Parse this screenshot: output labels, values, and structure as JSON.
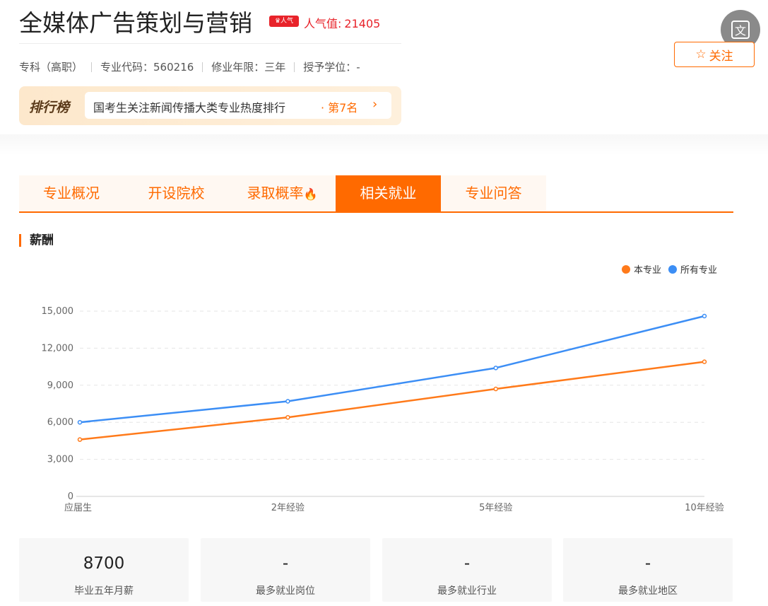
{
  "header": {
    "title": "全媒体广告策划与营销",
    "hot_badge": "人气",
    "popularity_label": "人气值:",
    "popularity_value": "21405",
    "meta": [
      "专科（高职）",
      "专业代码：560216",
      "修业年限：三年",
      "授予学位：-"
    ]
  },
  "ranking": {
    "title": "排行榜",
    "text": "国考生关注新闻传播大类专业热度排行",
    "position": "· 第7名",
    "arrow": "›"
  },
  "translate_button": {
    "label": "文"
  },
  "follow_button": {
    "star": "☆",
    "label": "关注"
  },
  "tabs": [
    {
      "label": "专业概况",
      "active": false
    },
    {
      "label": "开设院校",
      "active": false
    },
    {
      "label": "录取概率",
      "active": false
    },
    {
      "label": "相关就业",
      "active": true
    },
    {
      "label": "专业问答",
      "active": false
    }
  ],
  "tab_fire_icon": "🔥",
  "section": {
    "title": "薪酬"
  },
  "colors": {
    "accent": "#ff6a00",
    "series_major": "#ff7a1a",
    "series_all": "#3c8ef5"
  },
  "chart_data": {
    "type": "line",
    "categories": [
      "应届生",
      "2年经验",
      "5年经验",
      "10年经验"
    ],
    "series": [
      {
        "name": "本专业",
        "values": [
          4600,
          6400,
          8700,
          10900
        ],
        "color": "#ff7a1a"
      },
      {
        "name": "所有专业",
        "values": [
          6000,
          7700,
          10400,
          14600
        ],
        "color": "#3c8ef5"
      }
    ],
    "ylim": [
      0,
      15000
    ],
    "yticks": [
      0,
      3000,
      6000,
      9000,
      12000,
      15000
    ],
    "ytick_labels": [
      "0",
      "3,000",
      "6,000",
      "9,000",
      "12,000",
      "15,000"
    ],
    "legend": "top-right",
    "grid": true
  },
  "stats": [
    {
      "value": "8700",
      "label": "毕业五年月薪"
    },
    {
      "value": "-",
      "label": "最多就业岗位"
    },
    {
      "value": "-",
      "label": "最多就业行业"
    },
    {
      "value": "-",
      "label": "最多就业地区"
    }
  ]
}
